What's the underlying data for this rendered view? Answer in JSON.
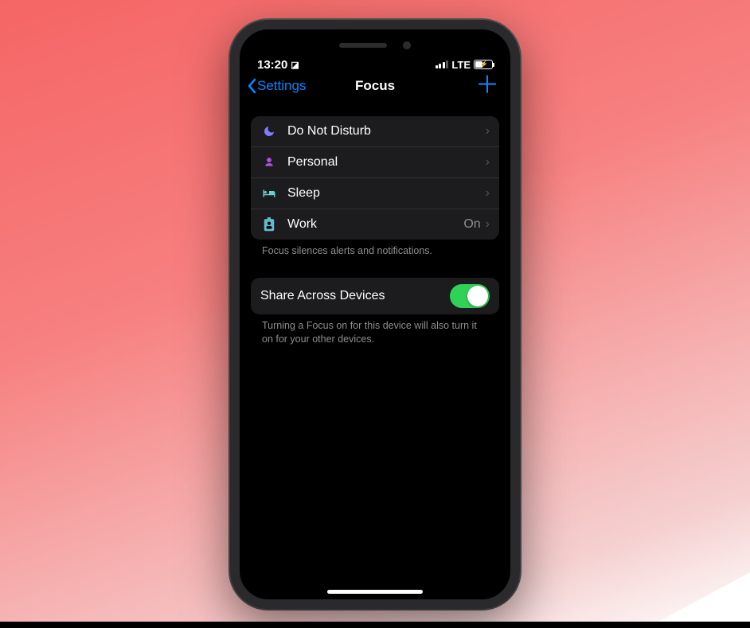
{
  "status": {
    "time": "13:20",
    "network": "LTE"
  },
  "nav": {
    "back_label": "Settings",
    "title": "Focus"
  },
  "focus_modes": [
    {
      "label": "Do Not Disturb",
      "icon": "moon",
      "color": "#7d7dff",
      "value": ""
    },
    {
      "label": "Personal",
      "icon": "person",
      "color": "#af52de",
      "value": ""
    },
    {
      "label": "Sleep",
      "icon": "bed",
      "color": "#64d2ce",
      "value": ""
    },
    {
      "label": "Work",
      "icon": "badge",
      "color": "#64b9d2",
      "value": "On"
    }
  ],
  "footer1": "Focus silences alerts and notifications.",
  "share": {
    "label": "Share Across Devices",
    "enabled": true
  },
  "footer2": "Turning a Focus on for this device will also turn it on for your other devices."
}
